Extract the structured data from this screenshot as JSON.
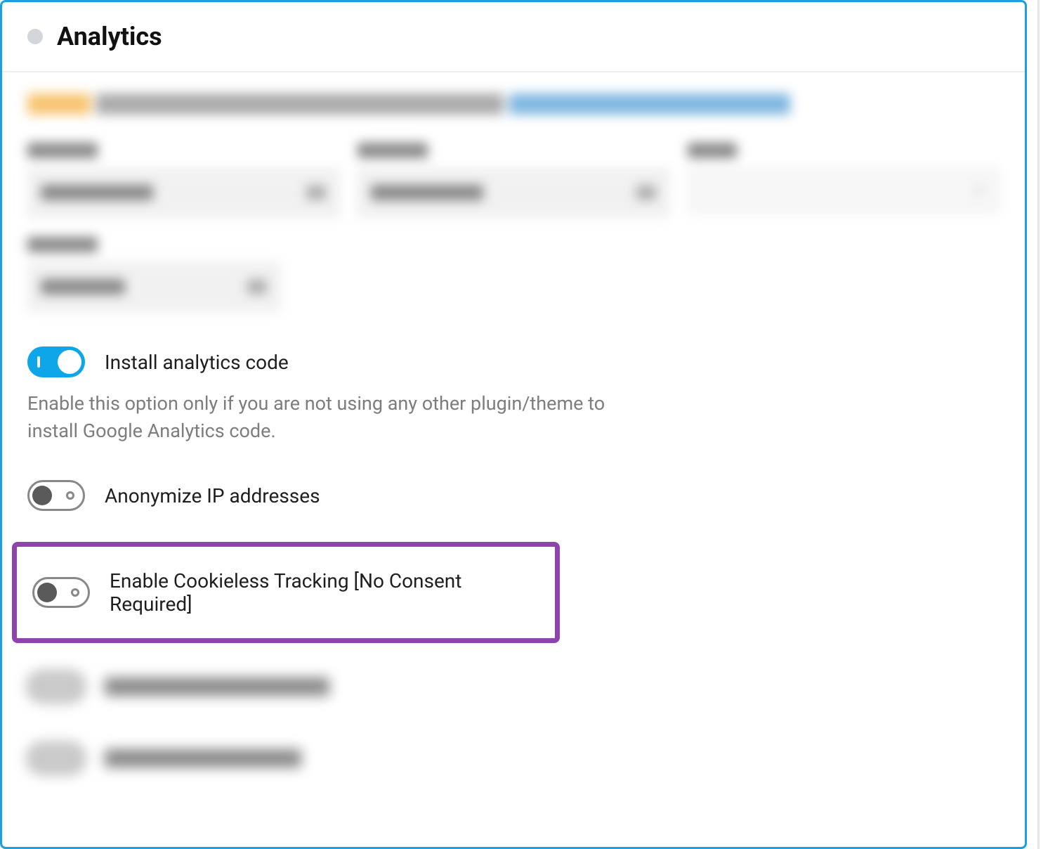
{
  "header": {
    "title": "Analytics"
  },
  "toggles": {
    "install": {
      "label": "Install analytics code",
      "help": "Enable this option only if you are not using any other plugin/theme to install Google Analytics code.",
      "enabled": true
    },
    "anonymize": {
      "label": "Anonymize IP addresses",
      "enabled": false
    },
    "cookieless": {
      "label": "Enable Cookieless Tracking [No Consent Required]",
      "enabled": false
    }
  }
}
